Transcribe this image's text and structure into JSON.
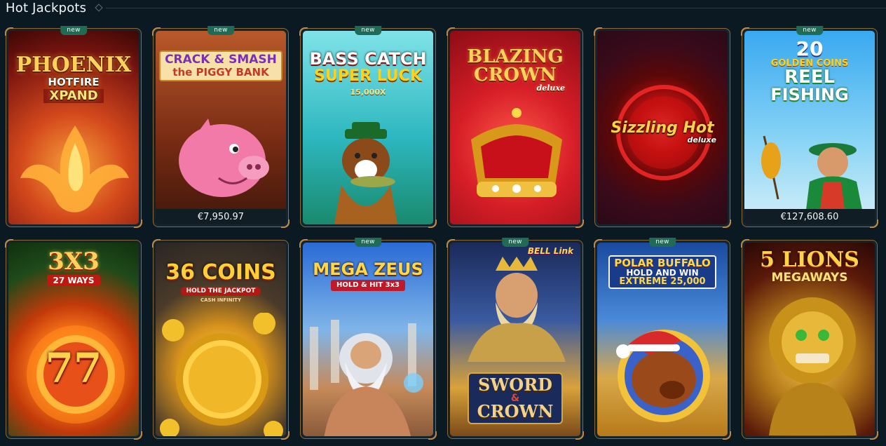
{
  "section": {
    "title": "Hot Jackpots"
  },
  "games": [
    {
      "title": "Phoenix Hotfire Xpand",
      "logo_lines": [
        "PHOENIX",
        "HOTFIRE",
        "XPAND"
      ],
      "new": true,
      "jackpot": ""
    },
    {
      "title": "Crack & Smash the Piggy Bank",
      "logo_lines": [
        "CRACK & SMASH",
        "the PIGGY BANK"
      ],
      "new": true,
      "jackpot": "€7,950.97"
    },
    {
      "title": "Bass Catch Super Luck",
      "logo_lines": [
        "BASS CATCH",
        "SUPER LUCK",
        "15,000X"
      ],
      "new": true,
      "jackpot": ""
    },
    {
      "title": "Blazing Crown Deluxe",
      "logo_lines": [
        "BLAZING",
        "CROWN",
        "deluxe"
      ],
      "new": false,
      "jackpot": ""
    },
    {
      "title": "Sizzling Hot Deluxe",
      "logo_lines": [
        "Sizzling Hot",
        "deluxe"
      ],
      "new": false,
      "jackpot": ""
    },
    {
      "title": "20 Golden Coins Reel Fishing",
      "logo_lines": [
        "20",
        "GOLDEN COINS",
        "REEL",
        "FISHING"
      ],
      "new": true,
      "jackpot": "€127,608.60"
    },
    {
      "title": "3x3 27 Ways",
      "logo_lines": [
        "3X3",
        "27 WAYS",
        "77"
      ],
      "new": false,
      "jackpot": ""
    },
    {
      "title": "36 Coins Hold the Jackpot",
      "logo_lines": [
        "36 COINS",
        "HOLD THE JACKPOT",
        "CASH INFINITY"
      ],
      "new": false,
      "jackpot": ""
    },
    {
      "title": "Mega Zeus Hold & Hit 3x3",
      "logo_lines": [
        "MEGA ZEUS",
        "HOLD & HIT 3x3"
      ],
      "new": true,
      "jackpot": ""
    },
    {
      "title": "Sword & Crown",
      "logo_lines": [
        "SWORD",
        "&",
        "CROWN",
        "BELL Link"
      ],
      "new": true,
      "jackpot": ""
    },
    {
      "title": "Polar Buffalo Hold and Win Extreme 25,000",
      "logo_lines": [
        "POLAR BUFFALO",
        "HOLD AND WIN",
        "EXTREME 25,000"
      ],
      "new": true,
      "jackpot": ""
    },
    {
      "title": "5 Lions Megaways",
      "logo_lines": [
        "5 LIONS",
        "MEGAWAYS"
      ],
      "new": false,
      "jackpot": ""
    }
  ],
  "labels": {
    "new_badge": "new"
  },
  "colors": {
    "background": "#0b1a22",
    "tile_border": "#8a6a3a",
    "new_badge": "#1f6b55",
    "jackpot_bar": "#111d24"
  }
}
